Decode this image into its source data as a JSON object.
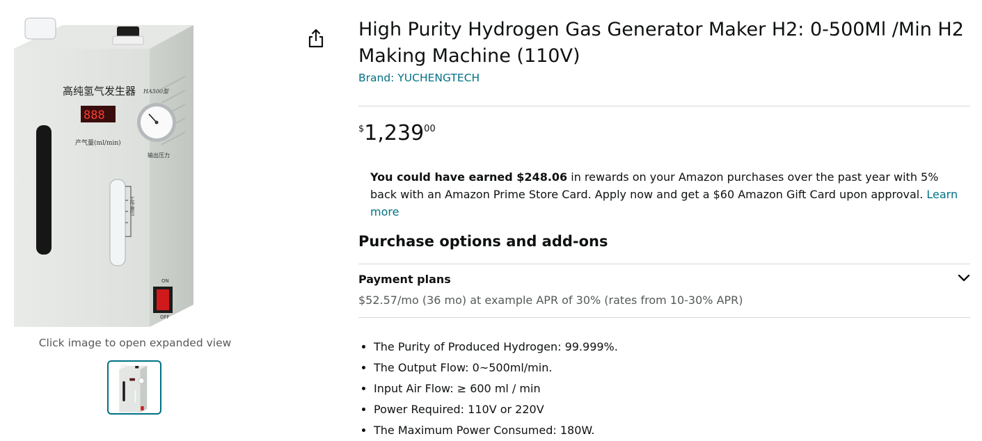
{
  "product": {
    "title": "High Purity Hydrogen Gas Generator Maker H2: 0-500Ml /Min H2 Making Machine (110V)",
    "brand": "Brand: YUCHENGTECH"
  },
  "image": {
    "caption": "Click image to open expanded view",
    "device_label_cn": "高纯氢气发生器",
    "device_model": "HA500型",
    "display_digits": "888",
    "flow_label": "产气量(ml/min)",
    "gauge_label": "输出压力",
    "level_label": "工作液位",
    "switch_on": "ON",
    "switch_off": "OFF"
  },
  "price": {
    "symbol": "$",
    "whole": "1,239",
    "fraction": "00"
  },
  "rewards": {
    "bold_text": "You could have earned $248.06",
    "text": " in rewards on your Amazon purchases over the past year with 5% back with an Amazon Prime Store Card. Apply now and get a $60 Amazon Gift Card upon approval. ",
    "link": "Learn more"
  },
  "purchase_options": {
    "heading": "Purchase options and add-ons",
    "payment_title": "Payment plans",
    "payment_detail": "$52.57/mo (36 mo) at example APR of 30% (rates from 10-30% APR)"
  },
  "features": [
    "The Purity of Produced Hydrogen: 99.999%.",
    "The Output Flow: 0~500ml/min.",
    "Input Air Flow: ≥ 600 ml / min",
    "Power Required: 110V or 220V",
    "The Maximum Power Consumed: 180W."
  ],
  "colors": {
    "link": "#007185",
    "text": "#0f1111",
    "secondary": "#565959",
    "divider": "#d5d9d9"
  },
  "icons": [
    "share-icon",
    "chevron-down-icon"
  ]
}
